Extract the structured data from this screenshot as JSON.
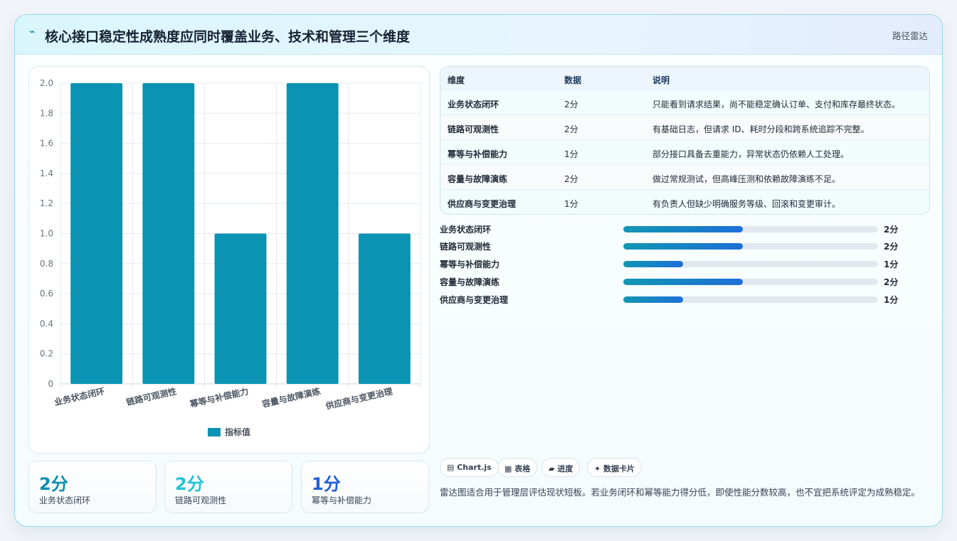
{
  "header": {
    "icon": "trend-icon",
    "title": "核心接口稳定性成熟度应同时覆盖业务、技术和管理三个维度",
    "tag": "路径雷达"
  },
  "chart_data": {
    "type": "bar",
    "categories": [
      "业务状态闭环",
      "链路可观测性",
      "幂等与补偿能力",
      "容量与故障演练",
      "供应商与变更治理"
    ],
    "series": [
      {
        "name": "指标值",
        "values": [
          2,
          2,
          1,
          2,
          1
        ]
      }
    ],
    "ylim": [
      0,
      2.0
    ],
    "yticks": [
      "0",
      "0.2",
      "0.4",
      "0.6",
      "0.8",
      "1.0",
      "1.2",
      "1.4",
      "1.6",
      "1.8",
      "2.0"
    ],
    "grid": true,
    "legend": "bottom",
    "color": "#0a93b3"
  },
  "stats": [
    {
      "value": "2分",
      "label": "业务状态闭环",
      "color": "#0a8fad"
    },
    {
      "value": "2分",
      "label": "链路可观测性",
      "color": "#22c2d6"
    },
    {
      "value": "1分",
      "label": "幂等与补偿能力",
      "color": "#1f5fd8"
    }
  ],
  "table": {
    "headers": [
      "维度",
      "数据",
      "说明"
    ],
    "rows": [
      [
        "业务状态闭环",
        "2分",
        "只能看到请求结果，尚不能稳定确认订单、支付和库存最终状态。"
      ],
      [
        "链路可观测性",
        "2分",
        "有基础日志，但请求 ID、耗时分段和跨系统追踪不完整。"
      ],
      [
        "幂等与补偿能力",
        "1分",
        "部分接口具备去重能力，异常状态仍依赖人工处理。"
      ],
      [
        "容量与故障演练",
        "2分",
        "做过常规测试，但高峰压测和依赖故障演练不足。"
      ],
      [
        "供应商与变更治理",
        "1分",
        "有负责人但缺少明确服务等级、回滚和变更审计。"
      ]
    ]
  },
  "progress": [
    {
      "label": "业务状态闭环",
      "value": "2分",
      "fraction": 0.47
    },
    {
      "label": "链路可观测性",
      "value": "2分",
      "fraction": 0.47
    },
    {
      "label": "幂等与补偿能力",
      "value": "1分",
      "fraction": 0.235
    },
    {
      "label": "容量与故障演练",
      "value": "2分",
      "fraction": 0.47
    },
    {
      "label": "供应商与变更治理",
      "value": "1分",
      "fraction": 0.235
    }
  ],
  "chips": [
    "▤ Chart.js",
    "▦ 表格",
    "▰ 进度",
    "✦ 数据卡片"
  ],
  "note": "雷达图适合用于管理层评估现状短板。若业务闭环和幂等能力得分低，即使性能分数较高，也不宜把系统评定为成熟稳定。"
}
